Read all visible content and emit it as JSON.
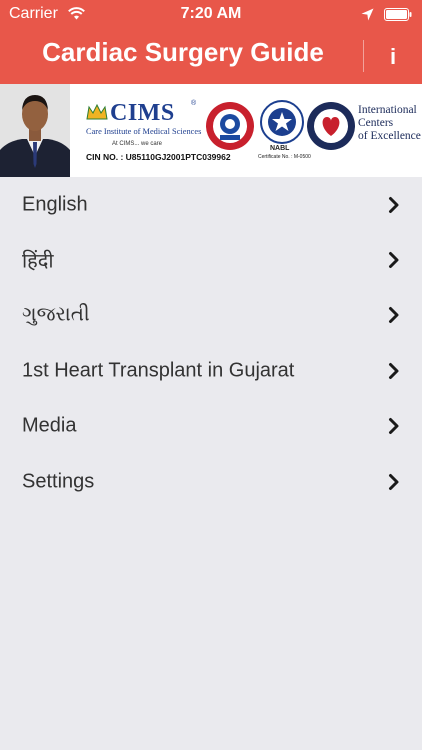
{
  "status_bar": {
    "carrier": "Carrier",
    "time": "7:20 AM",
    "icons": [
      "wifi-icon",
      "location-icon",
      "battery-icon"
    ]
  },
  "nav": {
    "title": "Cardiac Surgery Guide",
    "info_label": "i"
  },
  "banner": {
    "cims_name": "CIMS",
    "cims_reg": "®",
    "cims_full": "Care Institute of Medical Sciences",
    "cims_tagline": "At CIMS... we care",
    "cin": "CIN NO. : U85110GJ2001PTC039962",
    "nabl_label": "NABL",
    "nabl_certificate": "Certificate No. : M-0500",
    "intl_line1": "International",
    "intl_line2": "Centers",
    "intl_line3": "of Excellence"
  },
  "menu": {
    "items": [
      {
        "label": "English"
      },
      {
        "label": "हिंदी"
      },
      {
        "label": "ગુજરાતી"
      },
      {
        "label": "1st Heart Transplant in Gujarat"
      },
      {
        "label": "Media"
      },
      {
        "label": "Settings"
      }
    ]
  },
  "colors": {
    "header": "#e8574a",
    "background": "#eaeaee",
    "text": "#333333",
    "chevron": "#1a1a1a"
  }
}
